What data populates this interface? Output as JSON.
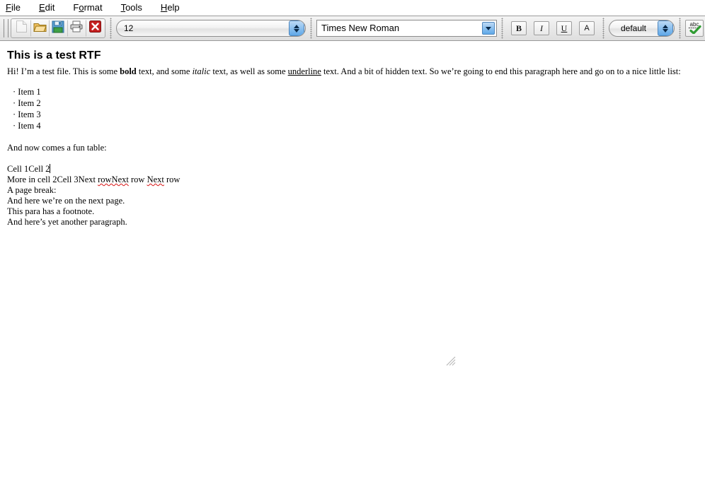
{
  "menubar": {
    "items": [
      {
        "name": "file",
        "pre": "",
        "key": "F",
        "post": "ile"
      },
      {
        "name": "edit",
        "pre": "",
        "key": "E",
        "post": "dit"
      },
      {
        "name": "format",
        "pre": "F",
        "key": "o",
        "post": "rmat"
      },
      {
        "name": "tools",
        "pre": "",
        "key": "T",
        "post": "ools"
      },
      {
        "name": "help",
        "pre": "",
        "key": "H",
        "post": "elp"
      }
    ]
  },
  "toolbar": {
    "file_buttons": [
      {
        "icon": "new-document-icon",
        "label": "New",
        "disabled": true
      },
      {
        "icon": "open-folder-icon",
        "label": "Open",
        "disabled": false
      },
      {
        "icon": "save-floppy-icon",
        "label": "Save",
        "disabled": false
      },
      {
        "icon": "printer-icon",
        "label": "Print",
        "disabled": false
      },
      {
        "icon": "close-x-icon",
        "label": "Close",
        "disabled": false
      }
    ],
    "font_size": {
      "value": "12",
      "name": "font-size-spinner"
    },
    "font_name": {
      "value": "Times New Roman",
      "name": "font-name-combobox"
    },
    "bold_label": "B",
    "italic_label": "I",
    "underline_label": "U",
    "font_effect_label": "A",
    "style": {
      "value": "default",
      "name": "paragraph-style-spinner"
    },
    "spellcheck": {
      "label": "abc",
      "name": "spellcheck-button"
    }
  },
  "document": {
    "heading": "This is a test RTF",
    "intro": {
      "part1": "Hi! I’m a test file. This is some ",
      "bold": "bold",
      "part2": " text, and some ",
      "italic": "italic",
      "part3": " text, as well as some ",
      "underline": "underline",
      "part4": " text. And a bit of hidden text. So we’re going to end this paragraph here and go on to a nice little list:"
    },
    "list": [
      "· Item 1",
      "· Item 2",
      "· Item 3",
      "· Item 4"
    ],
    "table_intro": "And now comes a fun table:",
    "table_row1": "Cell 1Cell 2",
    "table_row2": {
      "part1": "More in cell 2Cell 3Next ",
      "misspelled1": "rowNext",
      "part2": " row ",
      "misspelled2": "Next",
      "part3": " row"
    },
    "paragraphs": [
      "A page break:",
      "And here we’re on the next page.",
      "This para has a footnote.",
      "And here’s yet another paragraph."
    ]
  }
}
